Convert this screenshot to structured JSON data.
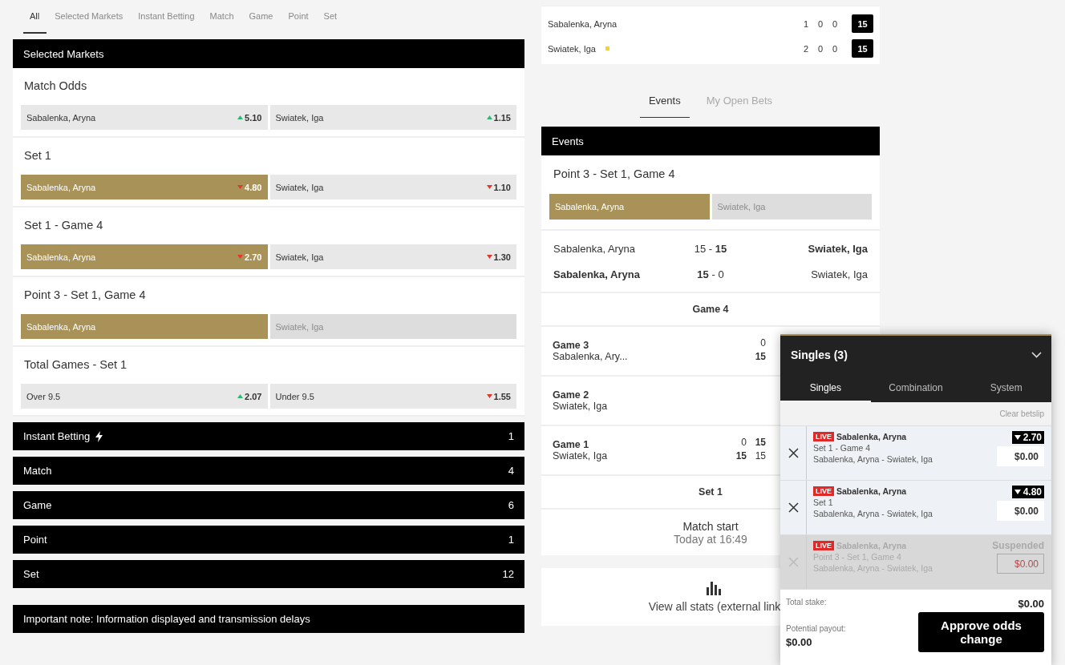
{
  "filter_tabs": [
    {
      "label": "All",
      "selected": true
    },
    {
      "label": "Selected Markets",
      "selected": false
    },
    {
      "label": "Instant Betting",
      "selected": false
    },
    {
      "label": "Match",
      "selected": false
    },
    {
      "label": "Game",
      "selected": false
    },
    {
      "label": "Point",
      "selected": false
    },
    {
      "label": "Set",
      "selected": false
    }
  ],
  "selected_markets": {
    "title": "Selected Markets",
    "markets": [
      {
        "title": "Match Odds",
        "selections": [
          {
            "name": "Sabalenka, Aryna",
            "odds": "5.10",
            "rising": true,
            "selected": false,
            "suspended": false
          },
          {
            "name": "Swiatek, Iga",
            "odds": "1.15",
            "rising": true,
            "selected": false,
            "suspended": false
          }
        ]
      },
      {
        "title": "Set 1",
        "selections": [
          {
            "name": "Sabalenka, Aryna",
            "odds": "4.80",
            "rising": false,
            "selected": true,
            "suspended": false
          },
          {
            "name": "Swiatek, Iga",
            "odds": "1.10",
            "rising": false,
            "selected": false,
            "suspended": false
          }
        ]
      },
      {
        "title": "Set 1 - Game 4",
        "selections": [
          {
            "name": "Sabalenka, Aryna",
            "odds": "2.70",
            "rising": false,
            "selected": true,
            "suspended": false
          },
          {
            "name": "Swiatek, Iga",
            "odds": "1.30",
            "rising": false,
            "selected": false,
            "suspended": false
          }
        ]
      },
      {
        "title": "Point 3 - Set 1, Game 4",
        "selections": [
          {
            "name": "Sabalenka, Aryna",
            "selected": true,
            "suspended": false
          },
          {
            "name": "Swiatek, Iga",
            "selected": false,
            "suspended": true
          }
        ]
      },
      {
        "title": "Total Games - Set 1",
        "selections": [
          {
            "name": "Over 9.5",
            "odds": "2.07",
            "rising": true,
            "selected": false,
            "suspended": false
          },
          {
            "name": "Under 9.5",
            "odds": "1.55",
            "rising": false,
            "selected": false,
            "suspended": false
          }
        ]
      }
    ]
  },
  "categories": [
    {
      "label": "Instant Betting",
      "count": "1",
      "kind": "instant"
    },
    {
      "label": "Match",
      "count": "4",
      "kind": "plain"
    },
    {
      "label": "Game",
      "count": "6",
      "kind": "plain"
    },
    {
      "label": "Point",
      "count": "1",
      "kind": "plain"
    },
    {
      "label": "Set",
      "count": "12",
      "kind": "plain"
    }
  ],
  "note": "Important note: Information displayed and transmission delays",
  "scoreboard": {
    "players": [
      {
        "name": "Sabalenka, Aryna",
        "serving": false,
        "sets": [
          "1",
          "0",
          "0"
        ],
        "points": "15"
      },
      {
        "name": "Swiatek, Iga",
        "serving": true,
        "sets": [
          "2",
          "0",
          "0"
        ],
        "points": "15"
      }
    ]
  },
  "event_tabs": [
    {
      "label": "Events",
      "selected": true
    },
    {
      "label": "My Open Bets",
      "selected": false
    }
  ],
  "events": {
    "title": "Events",
    "market": {
      "title": "Point 3 - Set 1, Game 4",
      "selections": [
        {
          "name": "Sabalenka, Aryna",
          "selected": true,
          "suspended": false
        },
        {
          "name": "Swiatek, Iga",
          "selected": false,
          "suspended": true
        }
      ]
    },
    "points": [
      {
        "home": "Sabalenka, Aryna",
        "score": "15 - **15**",
        "away": "Swiatek, Iga",
        "home_won": false
      },
      {
        "home": "Sabalenka, Aryna",
        "score": "**15** - 0",
        "away": "Swiatek, Iga",
        "home_won": true
      }
    ],
    "game_heading": "Game 4",
    "games": [
      {
        "title": "Game 3",
        "player": "Sabalenka, Ary...",
        "top": [
          {
            "value": "0",
            "bold": false
          }
        ],
        "bottom": [
          {
            "value": "15",
            "bold": true
          }
        ]
      },
      {
        "title": "Game 2",
        "player": "Swiatek, Iga"
      },
      {
        "title": "Game 1",
        "player": "Swiatek, Iga",
        "top": [
          {
            "value": "0",
            "bold": false
          },
          {
            "value": "15",
            "bold": true
          }
        ],
        "bottom": [
          {
            "value": "15",
            "bold": true
          },
          {
            "value": "15",
            "bold": false
          }
        ]
      }
    ],
    "set_heading": "Set 1",
    "match_start": {
      "label": "Match start",
      "time": "Today at 16:49"
    }
  },
  "stats_link": "View all stats (external link",
  "betslip": {
    "title": "Singles (3)",
    "tabs": [
      {
        "label": "Singles",
        "selected": true
      },
      {
        "label": "Combination",
        "selected": false
      },
      {
        "label": "System",
        "selected": false
      }
    ],
    "clear": "Clear betslip",
    "bets": [
      {
        "live": "LIVE",
        "selection": "Sabalenka, Aryna",
        "market": "Set 1 - Game 4",
        "event": "Sabalenka, Aryna - Swiatek, Iga",
        "odds": "2.70",
        "stake": "$0.00",
        "suspended": false
      },
      {
        "live": "LIVE",
        "selection": "Sabalenka, Aryna",
        "market": "Set 1",
        "event": "Sabalenka, Aryna - Swiatek, Iga",
        "odds": "4.80",
        "stake": "$0.00",
        "suspended": false
      },
      {
        "live": "LIVE",
        "selection": "Sabalenka, Aryna",
        "market": "Point 3 - Set 1, Game 4",
        "event": "Sabalenka, Aryna - Swiatek, Iga",
        "status": "Suspended",
        "stake": "$0.00",
        "suspended": true
      }
    ],
    "total_stake_label": "Total stake:",
    "total_stake": "$0.00",
    "payout_label": "Potential payout:",
    "payout": "$0.00",
    "approve": "Approve odds change"
  }
}
